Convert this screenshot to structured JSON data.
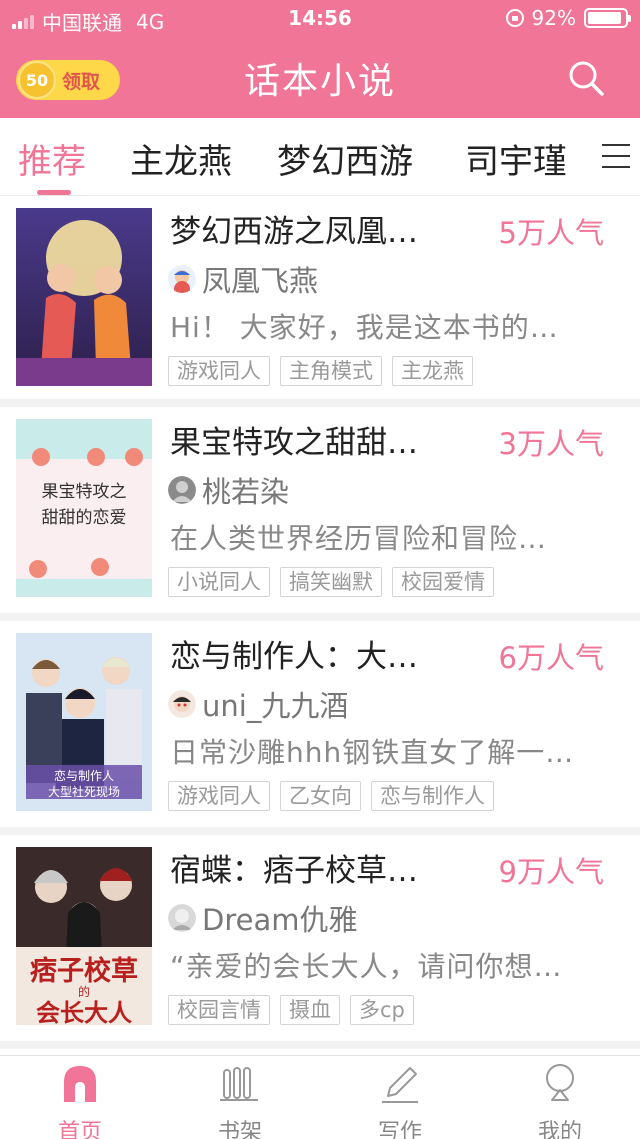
{
  "status_bar": {
    "carrier": "中国联通",
    "network": "4G",
    "time": "14:56",
    "battery": "92%",
    "battery_level": 0.92
  },
  "header": {
    "coin_amount": "50",
    "coin_label": "领取",
    "title": "话本小说"
  },
  "tabs": [
    {
      "label": "推荐",
      "active": true
    },
    {
      "label": "主龙燕",
      "active": false
    },
    {
      "label": "梦幻西游",
      "active": false
    },
    {
      "label": "司宇瑾",
      "active": false
    }
  ],
  "books": [
    {
      "title": "梦幻西游之凤凰…",
      "popularity": "5万人气",
      "author": "凤凰飞燕",
      "description": "Hi！ 大家好，我是这本书的…",
      "tags": [
        "游戏同人",
        "主角模式",
        "主龙燕"
      ]
    },
    {
      "title": "果宝特攻之甜甜…",
      "popularity": "3万人气",
      "author": "桃若染",
      "description": "在人类世界经历冒险和冒险…",
      "tags": [
        "小说同人",
        "搞笑幽默",
        "校园爱情"
      ],
      "cover_text": [
        "果宝特攻之",
        "甜甜的恋爱"
      ]
    },
    {
      "title": "恋与制作人：大…",
      "popularity": "6万人气",
      "author": "uni_九九酒",
      "description": "日常沙雕hhh钢铁直女了解一…",
      "tags": [
        "游戏同人",
        "乙女向",
        "恋与制作人"
      ],
      "cover_text": [
        "恋与制作人",
        "大型社死现场"
      ]
    },
    {
      "title": "宿蝶：痞子校草…",
      "popularity": "9万人气",
      "author": "Dream仇雅",
      "description": "“亲爱的会长大人，请问你想…",
      "tags": [
        "校园言情",
        "摄血",
        "多cp"
      ],
      "cover_text": [
        "痞子校草",
        "的",
        "会长大人"
      ]
    }
  ],
  "bottom_nav": [
    {
      "label": "首页",
      "icon": "home-icon",
      "active": true
    },
    {
      "label": "书架",
      "icon": "bookshelf-icon",
      "active": false
    },
    {
      "label": "写作",
      "icon": "pencil-icon",
      "active": false
    },
    {
      "label": "我的",
      "icon": "profile-icon",
      "active": false
    }
  ],
  "colors": {
    "brand_pink": "#f07596",
    "coin_yellow": "#ffd84a"
  }
}
